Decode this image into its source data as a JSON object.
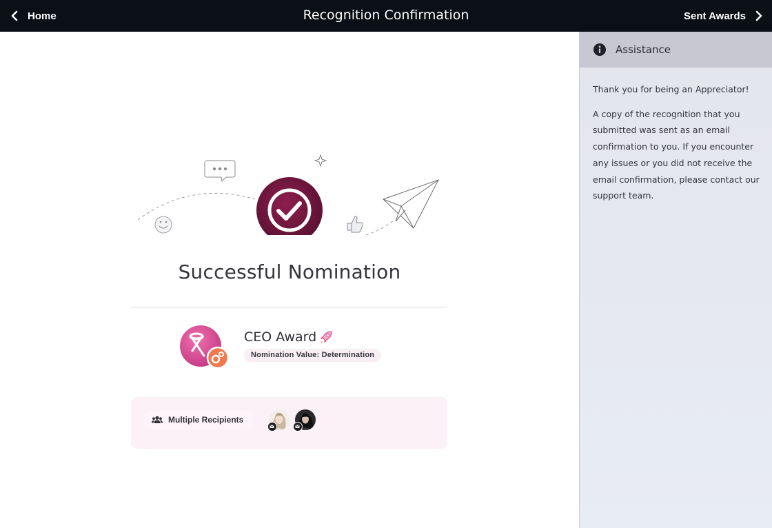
{
  "header": {
    "back_label": "Home",
    "title": "Recognition Confirmation",
    "forward_label": "Sent Awards"
  },
  "main": {
    "success_title": "Successful Nomination",
    "award": {
      "name": "CEO Award",
      "value_label": "Nomination Value: Determination"
    },
    "recipients": {
      "label": "Multiple Recipients"
    }
  },
  "sidebar": {
    "title": "Assistance",
    "paragraph_1": "Thank you for being an Appreciator!",
    "paragraph_2": "A copy of the recognition that you submitted was sent as an email confirmation to you. If you encounter any issues or you did not receive the email confirmation, please contact our support team."
  },
  "colors": {
    "topbar": "#0b0f16",
    "accent": "#7a1a45",
    "badge_pink": "#d9478f",
    "gear_orange": "#ee7a4d",
    "sidebar_head": "#c8c8d3"
  },
  "icons": {
    "back": "chevron-left-icon",
    "forward": "chevron-right-icon",
    "info": "info-icon",
    "check": "check-circle-icon",
    "award_badge": "award-badge-icon",
    "gear": "gear-icon",
    "rocket": "rocket-icon",
    "people": "people-icon",
    "mail": "mail-icon"
  }
}
